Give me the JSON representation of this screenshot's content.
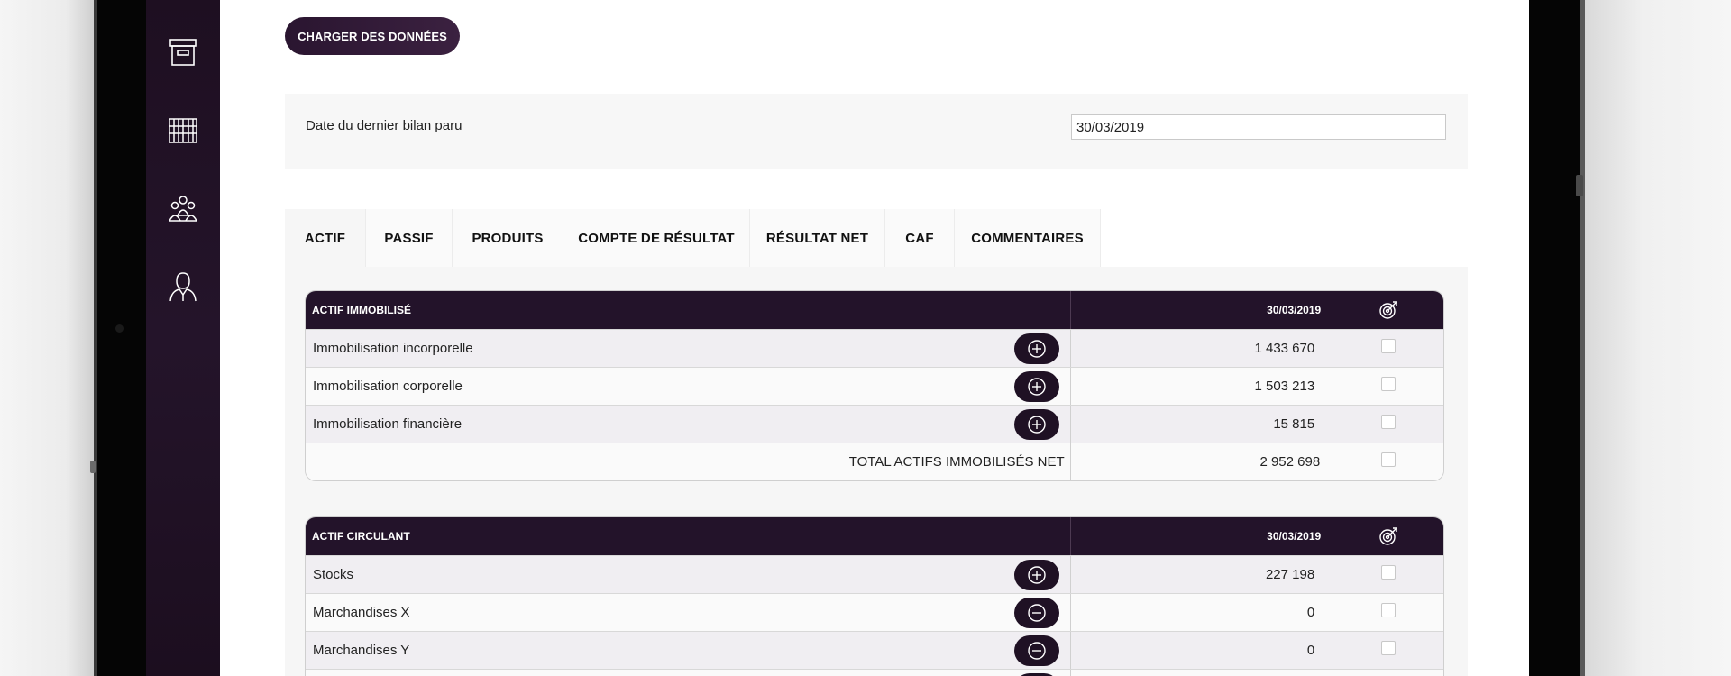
{
  "header": {
    "load_button": "CHARGER DES DONNÉES"
  },
  "date_section": {
    "label": "Date du dernier bilan paru",
    "value": "30/03/2019"
  },
  "tabs": [
    "ACTIF",
    "PASSIF",
    "PRODUITS",
    "COMPTE DE RÉSULTAT",
    "RÉSULTAT NET",
    "CAF",
    "COMMENTAIRES"
  ],
  "sidebar": {
    "icons": [
      "archive-box-icon",
      "bookshelf-icon",
      "team-icon",
      "user-icon"
    ]
  },
  "actif_immobilise": {
    "title": "ACTIF IMMOBILISÉ",
    "date": "30/03/2019",
    "rows": [
      {
        "label": "Immobilisation incorporelle",
        "value": "1 433 670",
        "toggle": "plus"
      },
      {
        "label": "Immobilisation corporelle",
        "value": "1 503 213",
        "toggle": "plus"
      },
      {
        "label": "Immobilisation financière",
        "value": "15 815",
        "toggle": "plus"
      }
    ],
    "total": {
      "label": "TOTAL ACTIFS IMMOBILISÉS NET",
      "value": "2 952 698"
    }
  },
  "actif_circulant": {
    "title": "ACTIF CIRCULANT",
    "date": "30/03/2019",
    "rows": [
      {
        "label": "Stocks",
        "value": "227 198",
        "toggle": "plus"
      },
      {
        "label": "Marchandises X",
        "value": "0",
        "toggle": "minus"
      },
      {
        "label": "Marchandises Y",
        "value": "0",
        "toggle": "minus"
      }
    ]
  },
  "colors": {
    "primary_dark": "#23132a",
    "sidebar": "#1e0f21",
    "row_alt": "#f0eef2"
  }
}
